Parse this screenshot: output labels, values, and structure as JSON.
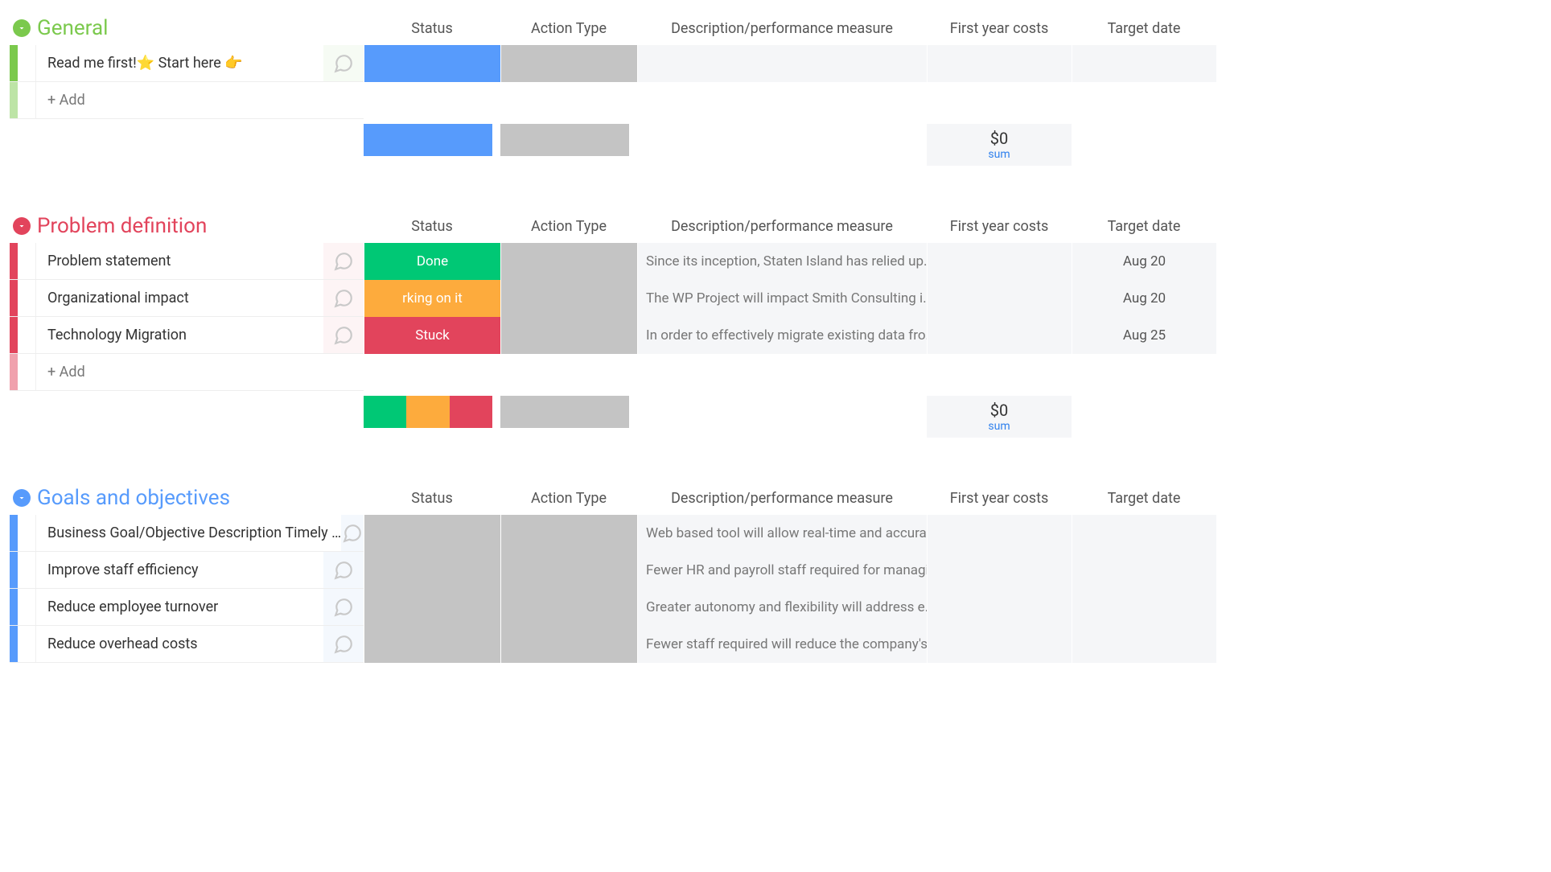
{
  "columns": [
    "Status",
    "Action Type",
    "Description/performance measure",
    "First year costs",
    "Target date"
  ],
  "add_label": "+ Add",
  "sum_label": "sum",
  "colors": {
    "green": "#7bc94d",
    "red": "#e2445c",
    "blue": "#579bfc",
    "status_blue": "#579bfc",
    "status_green": "#00c875",
    "status_orange": "#fdab3d",
    "status_red": "#e2445c",
    "gray": "#c4c4c4"
  },
  "groups": [
    {
      "id": "general",
      "title": "General",
      "color": "#7bc94d",
      "tint": "bg-tint-green",
      "rows": [
        {
          "name": "Read me first!⭐ Start here 👉",
          "status": {
            "label": "",
            "color": "#579bfc"
          },
          "action": "gray",
          "description": "",
          "cost": "",
          "date": ""
        }
      ],
      "summary": {
        "status_segments": [
          {
            "color": "#579bfc",
            "flex": 1
          }
        ],
        "cost": "$0"
      }
    },
    {
      "id": "problem",
      "title": "Problem definition",
      "color": "#e2445c",
      "tint": "bg-tint-red",
      "rows": [
        {
          "name": "Problem statement",
          "status": {
            "label": "Done",
            "color": "#00c875"
          },
          "action": "gray",
          "description": "Since its inception, Staten Island has relied up…",
          "cost": "",
          "date": "Aug 20"
        },
        {
          "name": "Organizational impact",
          "status": {
            "label": "rking on it",
            "color": "#fdab3d"
          },
          "action": "gray",
          "description": "The WP Project will impact Smith Consulting i…",
          "cost": "",
          "date": "Aug 20"
        },
        {
          "name": "Technology Migration",
          "status": {
            "label": "Stuck",
            "color": "#e2445c"
          },
          "action": "gray",
          "description": "In order to effectively migrate existing data fro…",
          "cost": "",
          "date": "Aug 25"
        }
      ],
      "summary": {
        "status_segments": [
          {
            "color": "#00c875",
            "flex": 1
          },
          {
            "color": "#fdab3d",
            "flex": 1
          },
          {
            "color": "#e2445c",
            "flex": 1
          }
        ],
        "cost": "$0"
      }
    },
    {
      "id": "goals",
      "title": "Goals and objectives",
      "color": "#579bfc",
      "tint": "bg-tint-blue",
      "rows": [
        {
          "name": "Business Goal/Objective Description Timely …",
          "status": {
            "label": "",
            "color": "#c4c4c4"
          },
          "action": "gray",
          "description": "Web based tool will allow real-time and accura…",
          "cost": "",
          "date": ""
        },
        {
          "name": "Improve staff efficiency",
          "status": {
            "label": "",
            "color": "#c4c4c4"
          },
          "action": "gray",
          "description": "Fewer HR and payroll staff required for managi…",
          "cost": "",
          "date": ""
        },
        {
          "name": "Reduce employee turnover",
          "status": {
            "label": "",
            "color": "#c4c4c4"
          },
          "action": "gray",
          "description": "Greater autonomy and flexibility will address e…",
          "cost": "",
          "date": ""
        },
        {
          "name": "Reduce overhead costs",
          "status": {
            "label": "",
            "color": "#c4c4c4"
          },
          "action": "gray",
          "description": "Fewer staff required will reduce the company's…",
          "cost": "",
          "date": ""
        }
      ],
      "summary": null
    }
  ]
}
